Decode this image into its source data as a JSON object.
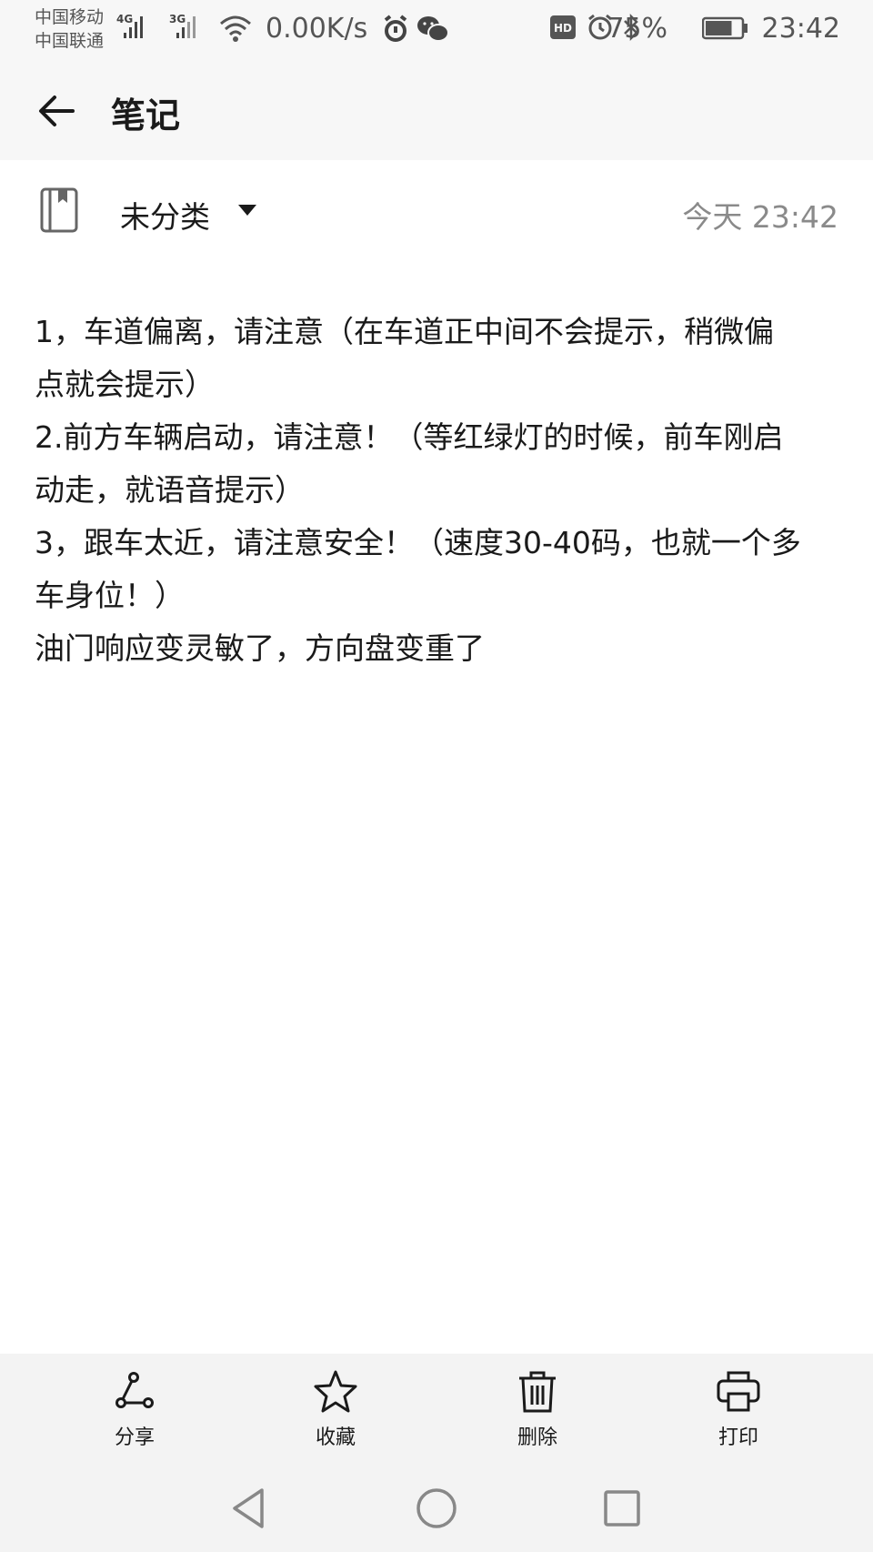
{
  "status_bar": {
    "carrier_1": "中国移动",
    "carrier_2": "中国联通",
    "signal_1_type": "4G",
    "signal_2_type": "3G",
    "net_speed": "0.00K/s",
    "battery_percent": "75%",
    "battery_level": 0.75,
    "time": "23:42",
    "icons": [
      "signal-4g-icon",
      "signal-3g-icon",
      "wifi-icon",
      "alarm-clock-icon",
      "wechat-icon",
      "hd-icon",
      "clock-icon",
      "bluetooth-icon",
      "battery-icon"
    ]
  },
  "header": {
    "back_icon": "arrow-left-icon",
    "title": "笔记"
  },
  "note": {
    "notebook_icon": "notebook-icon",
    "category": "未分类",
    "dropdown_icon": "triangle-down-icon",
    "time": "今天 23:42",
    "lines": [
      "1，车道偏离，请注意（在车道正中间不会提示，稍微偏",
      "点就会提示）",
      "2.前方车辆启动，请注意！（等红绿灯的时候，前车刚启",
      "动走，就语音提示）",
      "3，跟车太近，请注意安全！（速度30-40码，也就一个多",
      "车身位！）",
      "油门响应变灵敏了，方向盘变重了"
    ]
  },
  "toolbar": {
    "share": {
      "label": "分享",
      "icon": "share-icon"
    },
    "favorite": {
      "label": "收藏",
      "icon": "star-icon"
    },
    "delete": {
      "label": "删除",
      "icon": "trash-icon"
    },
    "print": {
      "label": "打印",
      "icon": "printer-icon"
    }
  },
  "system_nav": {
    "back": "nav-back-icon",
    "home": "nav-home-icon",
    "recents": "nav-recents-icon"
  },
  "colors": {
    "background": "#f7f7f7",
    "content_bg": "#ffffff",
    "text": "#1a1a1a",
    "muted_text": "#8a8a8a"
  }
}
